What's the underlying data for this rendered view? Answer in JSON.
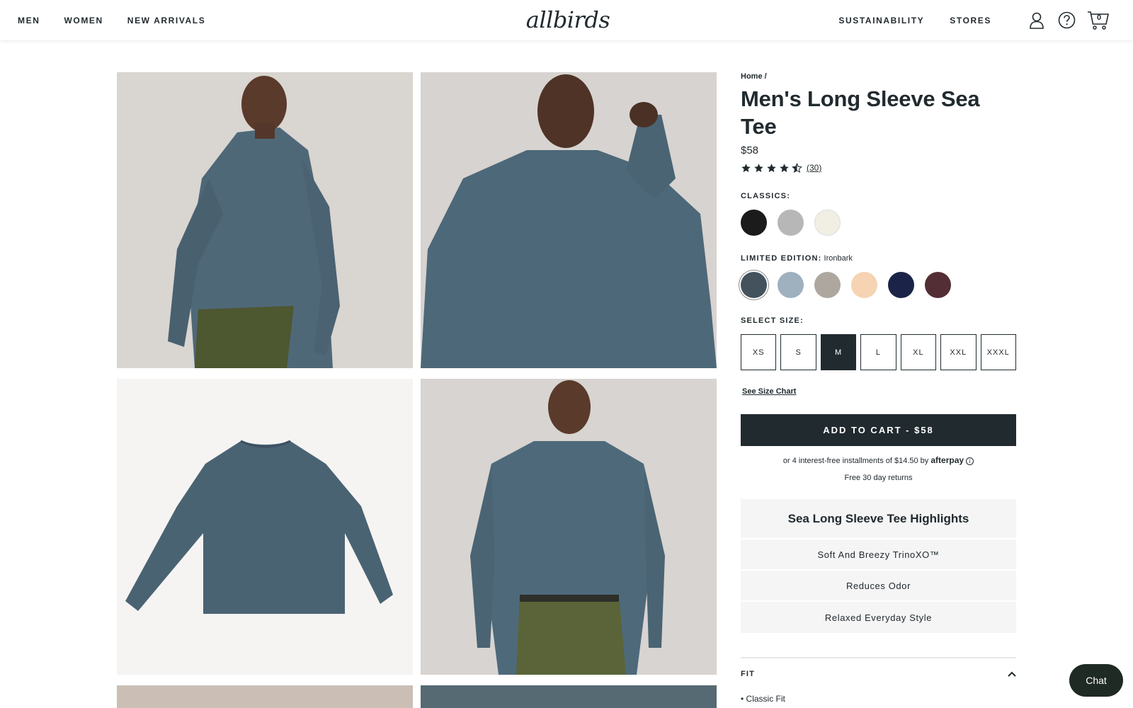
{
  "header": {
    "nav_left": [
      "MEN",
      "WOMEN",
      "NEW ARRIVALS"
    ],
    "logo": "allbirds",
    "nav_right": [
      "SUSTAINABILITY",
      "STORES"
    ],
    "cart_count": "0",
    "icons": [
      "account-icon",
      "help-icon",
      "cart-icon"
    ]
  },
  "product": {
    "breadcrumb": "Home /",
    "title": "Men's Long Sleeve Sea Tee",
    "price": "$58",
    "rating": 4.5,
    "reviews": "(30)",
    "classics_label": "CLASSICS:",
    "classics_colors": [
      "#1b1b1b",
      "#b8b7b7",
      "#f1efe4"
    ],
    "limited_label": "LIMITED EDITION:",
    "limited_selected": "Ironbark",
    "limited_colors": [
      "#43525c",
      "#9fb0bf",
      "#ada7a0",
      "#f6d3b2",
      "#1b2448",
      "#532e35"
    ],
    "size_label": "SELECT SIZE:",
    "sizes": [
      "XS",
      "S",
      "M",
      "L",
      "XL",
      "XXL",
      "XXXL"
    ],
    "selected_size": "M",
    "size_chart": "See Size Chart",
    "add_to_cart": "ADD TO CART - $58",
    "afterpay_text": "or 4 interest-free installments of $14.50 by",
    "afterpay_brand": "afterpay",
    "returns": "Free 30 day returns"
  },
  "highlights": {
    "title": "Sea Long Sleeve Tee Highlights",
    "items": [
      "Soft And Breezy TrinoXO™",
      "Reduces Odor",
      "Relaxed Everyday Style"
    ]
  },
  "fit": {
    "label": "FIT",
    "items": [
      "Classic Fit"
    ]
  },
  "chat": {
    "label": "Chat"
  }
}
